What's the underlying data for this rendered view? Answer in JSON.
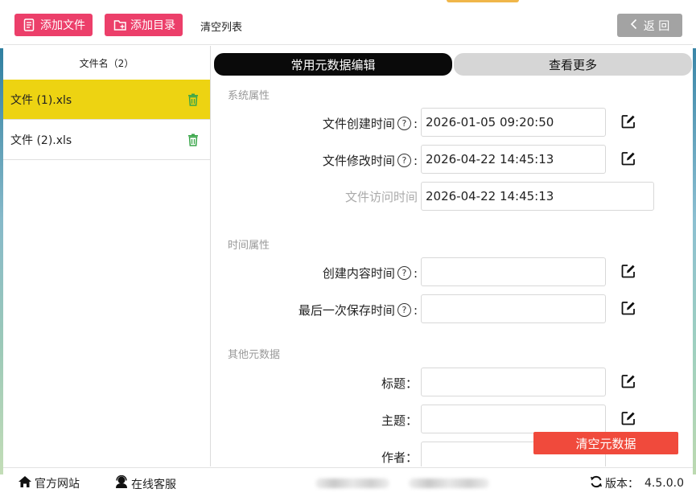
{
  "toolbar": {
    "add_file_label": "添加文件",
    "add_dir_label": "添加目录",
    "clear_list_label": "清空列表",
    "back_label": "返 回"
  },
  "files": {
    "header": "文件名（2）",
    "items": [
      {
        "name": "文件 (1).xls",
        "selected": true
      },
      {
        "name": "文件 (2).xls",
        "selected": false
      }
    ]
  },
  "tabs": {
    "common": "常用元数据编辑",
    "more": "查看更多"
  },
  "sections": {
    "system": "系统属性",
    "time": "时间属性",
    "other": "其他元数据"
  },
  "fields": {
    "created": {
      "label": "文件创建时间",
      "value": "2026-01-05 09:20:50"
    },
    "modified": {
      "label": "文件修改时间",
      "value": "2026-04-22 14:45:13"
    },
    "accessed": {
      "label": "文件访问时间",
      "value": "2026-04-22 14:45:13"
    },
    "content_created": {
      "label": "创建内容时间",
      "value": ""
    },
    "last_saved": {
      "label": "最后一次保存时间",
      "value": ""
    },
    "title": {
      "label": "标题：",
      "value": ""
    },
    "subject": {
      "label": "主题：",
      "value": ""
    },
    "author": {
      "label": "作者：",
      "value": ""
    }
  },
  "colon": ":",
  "help_glyph": "?",
  "clear_metadata_label": "清空元数据",
  "footer": {
    "website": "官方网站",
    "support": "在线客服",
    "version_label": "版本：",
    "version_value": "4.5.0.0"
  },
  "colors": {
    "primary_button": "#ec3f6a",
    "selected_row": "#edd312",
    "active_tab": "#0a0a0a",
    "inactive_tab": "#d6d6d6",
    "danger_button": "#f04a3c",
    "back_button": "#a3a3a3",
    "trash_icon": "#3aa64a"
  },
  "icons": {
    "add_file": "file-list-icon",
    "add_dir": "folder-add-icon",
    "back": "chevron-left-icon",
    "delete": "trash-icon",
    "help": "question-circle-icon",
    "edit": "edit-icon",
    "website": "home-icon",
    "support": "headset-user-icon",
    "version": "refresh-icon"
  }
}
